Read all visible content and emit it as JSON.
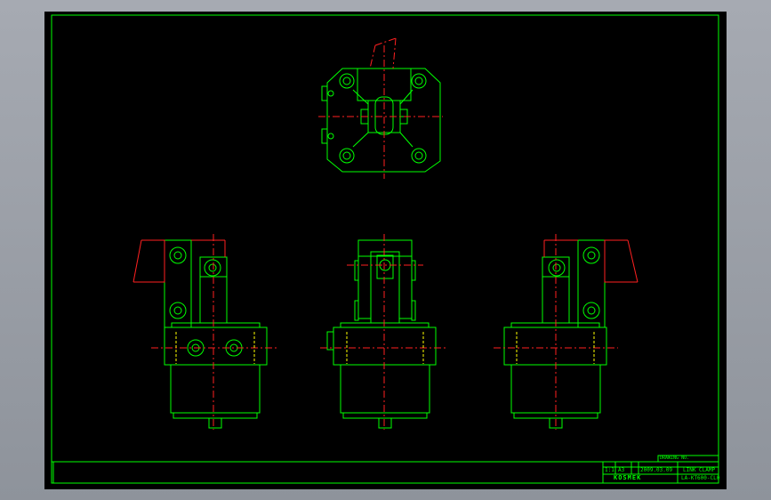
{
  "colors": {
    "background": "#000000",
    "outline": "#00ff00",
    "centerline": "#ff2020",
    "hidden": "#ffff00",
    "desktop": "#9a9ea6"
  },
  "title_block": {
    "drawing_no": "LA-KT600-CL0",
    "part_name": "LINK CLAMP",
    "date": "2009.03.09",
    "scale": "1:1",
    "size": "A3",
    "company": "KOSMEK",
    "header_label": "DRAWING NO."
  }
}
